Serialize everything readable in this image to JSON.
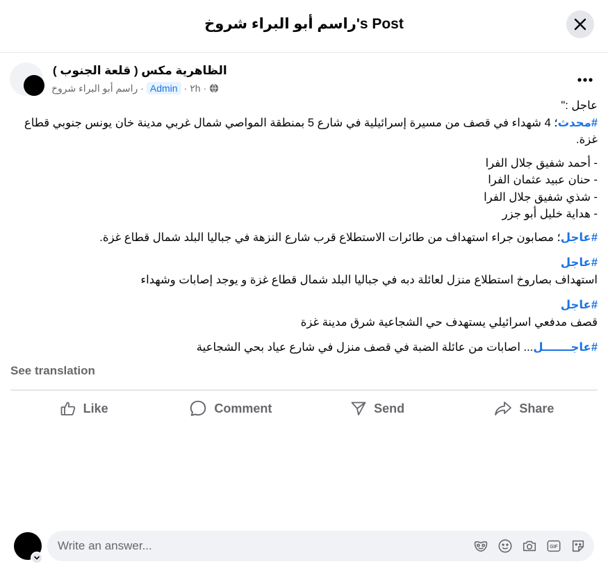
{
  "header": {
    "title": "راسم أبو البراء شروخ's Post"
  },
  "post": {
    "group_name": "الظاهرية مكس ( قلعة الجنوب )",
    "time": "٢h",
    "admin_label": "Admin",
    "author": "راسم أبو البراء شروخ",
    "paragraphs": {
      "p0": "عاجل :\"",
      "p1_tag": "#محدث",
      "p1_text": "؛ 4 شهداء في قصف من مسيرة إسرائيلية في شارع 5 بمنطقة المواصي شمال غربي مدينة خان يونس جنوبي قطاع غزة.",
      "names": [
        "- أحمد شفيق جلال الفرا",
        "- حنان عبيد عثمان الفرا",
        "- شذي شفيق جلال الفرا",
        "- هداية خليل أبو جزر"
      ],
      "p2_tag": "#عاجل",
      "p2_text": "؛ مصابون جراء استهداف من طائرات الاستطلاع قرب شارع النزهة في جباليا البلد شمال قطاع غزة.",
      "p3_tag": "#عاجل",
      "p3_text": "استهداف بصاروخ استطلاع منزل لعائلة دبه في جباليا البلد شمال قطاع غزة و يوجد إصابات وشهداء",
      "p4_tag": "#عاجل",
      "p4_text": "قصف مدفعي اسرائيلي يستهدف حي الشجاعية شرق مدينة غزة",
      "p5_tag": "#عاجـــــــل",
      "p5_text": "... اصابات من عائلة الضبة في قصف منزل في شارع عياد بحي الشجاعية"
    }
  },
  "see_translation": "See translation",
  "actions": {
    "like": "Like",
    "comment": "Comment",
    "send": "Send",
    "share": "Share"
  },
  "answer": {
    "placeholder": "Write an answer..."
  },
  "icons": {
    "close": "close-icon",
    "globe": "globe-icon",
    "more": "more-icon",
    "like": "thumbs-up-icon",
    "comment": "comment-bubble-icon",
    "send": "send-icon",
    "share": "share-arrow-icon",
    "avatar": "avatar-icon",
    "chevron": "chevron-down-icon",
    "emoji_mask": "mask-icon",
    "emoji": "smiley-icon",
    "camera": "camera-icon",
    "gif": "gif-icon",
    "sticker": "sticker-icon"
  },
  "colors": {
    "accent": "#1b74e4",
    "muted": "#65676b",
    "divider": "#ced0d4"
  }
}
